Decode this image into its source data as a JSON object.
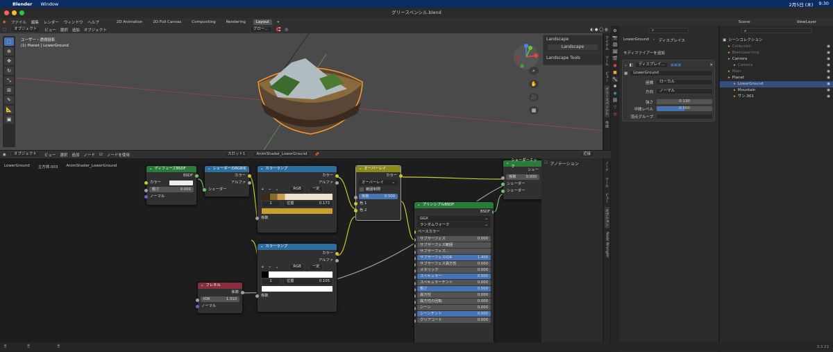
{
  "mac": {
    "app": "Blender",
    "menu": [
      "Window"
    ],
    "date": "2月5日 (木)",
    "time": "9:30"
  },
  "window": {
    "title": "グリースペンシル.blend"
  },
  "menubar": {
    "items": [
      "ファイル",
      "編集",
      "レンダー",
      "ウィンドウ",
      "ヘルプ"
    ],
    "tabs": [
      "2D Animation",
      "2D Full Canvas",
      "Compositing",
      "Rendering",
      "Layout"
    ],
    "active_tab": "Layout",
    "scene": "Scene",
    "view_layer": "ViewLayer"
  },
  "view3d": {
    "mode": "オブジェクト",
    "menus": [
      "ビュー",
      "選択",
      "追加",
      "オブジェクト"
    ],
    "transform": "グロー...",
    "overlay_title": "ユーザー・透視投影",
    "overlay_sub": "(1) Planet | LowerGround",
    "npanel": {
      "section": "Landscape",
      "button": "Landscape",
      "tools": "Landscape Tools"
    }
  },
  "nodeeditor": {
    "mode": "オブジェクト",
    "menus": [
      "ビュー",
      "選択",
      "追加",
      "ノード"
    ],
    "use_nodes": "ノードを使用",
    "slot": "スロット1",
    "material": "AnimShader_LowerGround",
    "breadcrumb": [
      "LowerGround",
      "立方体.003",
      "AnimShader_LowerGround"
    ],
    "options": "近接",
    "side_tabs": [
      "ノード",
      "ツール",
      "ビュー",
      "オプション",
      "Node Wrangler"
    ],
    "annotation": "アノテーション"
  },
  "nodes": {
    "diffuse": {
      "title": "ディフューズBSDF",
      "out": "BSDF",
      "color": "カラー",
      "rough": "粗さ",
      "rough_val": "0.000",
      "normal": "ノーマル"
    },
    "rgb2bw": {
      "title": "シェーダーのRGB化",
      "color": "カラー",
      "alpha": "アルファ",
      "shader": "シェーダー"
    },
    "ramp1": {
      "title": "カラーランプ",
      "color": "カラー",
      "alpha": "アルファ",
      "mode": "RGB",
      "interp": "一定",
      "idx": "1",
      "pos_label": "位置",
      "pos": "0.173",
      "fac": "係数"
    },
    "ramp2": {
      "title": "カラーランプ",
      "color": "カラー",
      "alpha": "アルファ",
      "mode": "RGB",
      "interp": "一定",
      "idx": "1",
      "pos_label": "位置",
      "pos": "0.105",
      "fac": "係数"
    },
    "overlay": {
      "title": "オーバーレイ",
      "color": "カラー",
      "blend": "オーバーレイ",
      "clamp": "範囲制限",
      "fac": "係数",
      "fac_val": "0.500",
      "c1": "色 1",
      "c2": "色 2"
    },
    "mix": {
      "title": "シェーダーミック",
      "shader_out": "シェー",
      "fac": "係数",
      "fac_val": "0.000",
      "s1": "シェーダー",
      "s2": "シェーダー"
    },
    "fresnel": {
      "title": "フレネル",
      "fac": "係数",
      "ior": "IOR",
      "ior_val": "1.310",
      "normal": "ノーマル"
    },
    "principled": {
      "title": "プリンシプルBSDF",
      "out": "BSDF",
      "dist": "GGX",
      "sss": "ランダムウォーク",
      "base": "ベースカラー",
      "rows": [
        {
          "label": "サブサーフェス",
          "value": "0.000",
          "hl": false
        },
        {
          "label": "サブサーフェス範囲",
          "value": "",
          "hl": false
        },
        {
          "label": "サブサーフェス...",
          "value": "",
          "hl": false
        },
        {
          "label": "サブサーフェスIOR",
          "value": "1.400",
          "hl": true
        },
        {
          "label": "サブサーフェス異方性",
          "value": "0.000",
          "hl": false
        },
        {
          "label": "メタリック",
          "value": "0.000",
          "hl": false
        },
        {
          "label": "スペキュラー",
          "value": "0.500",
          "hl": true
        },
        {
          "label": "スペキュラーチント",
          "value": "0.000",
          "hl": false
        },
        {
          "label": "粗さ",
          "value": "0.500",
          "hl": true
        },
        {
          "label": "異方性",
          "value": "0.000",
          "hl": false
        },
        {
          "label": "異方性の回転",
          "value": "0.000",
          "hl": false
        },
        {
          "label": "シーン",
          "value": "0.000",
          "hl": false
        },
        {
          "label": "シーンチント",
          "value": "0.500",
          "hl": true
        },
        {
          "label": "クリアコート",
          "value": "0.000",
          "hl": false
        }
      ]
    }
  },
  "properties": {
    "object": "LowerGround",
    "breadcrumb": "ディスプレイス",
    "add_modifier": "モディファイアーを追加",
    "mod_name": "ディスプレイ...",
    "texture": "LowerGround",
    "coords_label": "座標",
    "coords": "ローカル",
    "dir_label": "方向",
    "dir": "ノーマル",
    "strength_label": "強さ",
    "strength": "0.130",
    "mid_label": "中間レベル",
    "mid": "0.500",
    "vgroup_label": "頂点グループ"
  },
  "outliner": {
    "root": "シーンコレクション",
    "rows": [
      {
        "label": "Collection",
        "indent": 1,
        "dim": true,
        "sel": false
      },
      {
        "label": "BasicLearning",
        "indent": 1,
        "dim": true,
        "sel": false
      },
      {
        "label": "Camera",
        "indent": 1,
        "dim": false,
        "sel": false
      },
      {
        "label": "Camera",
        "indent": 2,
        "dim": true,
        "sel": false
      },
      {
        "label": "Main",
        "indent": 1,
        "dim": true,
        "sel": false
      },
      {
        "label": "Planet",
        "indent": 1,
        "dim": false,
        "sel": false
      },
      {
        "label": "LowerGround",
        "indent": 2,
        "dim": false,
        "sel": true
      },
      {
        "label": "Mountain",
        "indent": 2,
        "dim": false,
        "sel": false
      },
      {
        "label": "サン.001",
        "indent": 2,
        "dim": false,
        "sel": false
      }
    ]
  },
  "status": {
    "version": "3.3.21"
  },
  "colors": {
    "accent": "#4772b3",
    "select": "#334d80",
    "shader_header": "#2a7a3a",
    "converter_header": "#2c6e9e",
    "color_header": "#8a8a1a",
    "input_header": "#8a2d3c",
    "mix_header": "#2a7a3a"
  }
}
